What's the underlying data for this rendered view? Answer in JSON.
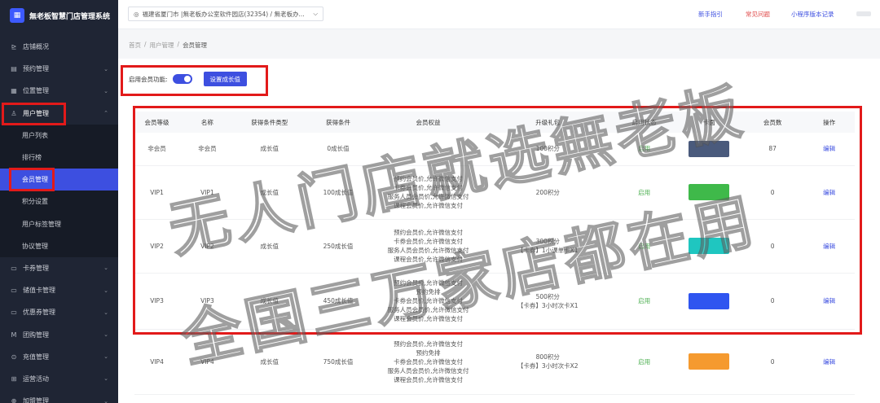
{
  "app": {
    "title": "無老板智慧门店管理系统"
  },
  "sidebar": {
    "items": [
      {
        "icon": "chart-icon",
        "glyph": "⊵",
        "label": "店铺概况",
        "has_chevron": false
      },
      {
        "icon": "calendar-icon",
        "glyph": "▤",
        "label": "预约管理",
        "has_chevron": true
      },
      {
        "icon": "grid-icon",
        "glyph": "▦",
        "label": "位置管理",
        "has_chevron": true
      },
      {
        "icon": "user-icon",
        "glyph": "♙",
        "label": "用户管理",
        "has_chevron": true,
        "open": true
      }
    ],
    "submenu": [
      {
        "label": "用户列表"
      },
      {
        "label": "排行榜"
      },
      {
        "label": "会员管理",
        "active": true
      },
      {
        "label": "积分设置"
      },
      {
        "label": "用户标签管理"
      },
      {
        "label": "协议管理"
      }
    ],
    "items_after": [
      {
        "icon": "card-icon",
        "glyph": "▭",
        "label": "卡券管理"
      },
      {
        "icon": "wallet-icon",
        "glyph": "▭",
        "label": "储值卡管理"
      },
      {
        "icon": "coupon-icon",
        "glyph": "▭",
        "label": "优惠券管理"
      },
      {
        "icon": "group-buy-icon",
        "glyph": "M",
        "label": "团购管理"
      },
      {
        "icon": "recharge-icon",
        "glyph": "⊙",
        "label": "充值管理"
      },
      {
        "icon": "gift-icon",
        "glyph": "⊞",
        "label": "运营活动"
      },
      {
        "icon": "plus-icon",
        "glyph": "⊕",
        "label": "加盟管理"
      }
    ]
  },
  "header": {
    "store": "福建省厦门市 |無老板办公室软件园店(32354) / 無老板办...",
    "links": {
      "guide": "新手指引",
      "faq": "常见问题",
      "changelog": "小程序版本记录"
    }
  },
  "breadcrumb": [
    "首页",
    "用户管理",
    "会员管理"
  ],
  "member_toggle": {
    "label": "启用会员功能:",
    "enabled": true,
    "button": "设置成长值"
  },
  "table": {
    "columns": [
      "会员等级",
      "名称",
      "获得条件类型",
      "获得条件",
      "会员权益",
      "升级礼包",
      "启用状态",
      "卡面",
      "会员数",
      "操作"
    ],
    "rows": [
      {
        "level": "非会员",
        "name": "非会员",
        "cond_type": "成长值",
        "cond": "0成长值",
        "rights": [],
        "gift": [
          "100积分"
        ],
        "status": "启用",
        "card": "#4a5a7c",
        "count": "87",
        "op": "编辑"
      },
      {
        "level": "VIP1",
        "name": "VIP1",
        "cond_type": "成长值",
        "cond": "100成长值",
        "rights": [
          "预约会员价,允许微信支付",
          "卡券会员价,允许微信支付",
          "服务人员会员价,允许微信支付",
          "课程会员价,允许微信支付"
        ],
        "gift": [
          "200积分"
        ],
        "status": "启用",
        "card": "#3fb94a",
        "count": "0",
        "op": "编辑"
      },
      {
        "level": "VIP2",
        "name": "VIP2",
        "cond_type": "成长值",
        "cond": "250成长值",
        "rights": [
          "预约会员价,允许微信支付",
          "卡券会员价,允许微信支付",
          "服务人员会员价,允许微信支付",
          "课程会员价,允许微信支付"
        ],
        "gift": [
          "300积分",
          "【卡券】1小课单卡X1"
        ],
        "status": "启用",
        "card": "#1fc6c0",
        "count": "0",
        "op": "编辑"
      },
      {
        "level": "VIP3",
        "name": "VIP3",
        "cond_type": "成长值",
        "cond": "450成长值",
        "rights": [
          "预约会员价,允许微信支付",
          "预约免排",
          "卡券会员价,允许微信支付",
          "服务人员会员价,允许微信支付",
          "课程会员价,允许微信支付"
        ],
        "gift": [
          "500积分",
          "【卡券】3小时次卡X1"
        ],
        "status": "启用",
        "card": "#2f55f0",
        "count": "0",
        "op": "编辑"
      },
      {
        "level": "VIP4",
        "name": "VIP4",
        "cond_type": "成长值",
        "cond": "750成长值",
        "rights": [
          "预约会员价,允许微信支付",
          "预约免排",
          "卡券会员价,允许微信支付",
          "服务人员会员价,允许微信支付",
          "课程会员价,允许微信支付"
        ],
        "gift": [
          "800积分",
          "【卡券】3小时次卡X2"
        ],
        "status": "启用",
        "card": "#f59a2f",
        "count": "0",
        "op": "编辑"
      }
    ]
  },
  "watermark": {
    "line1": "无人门店就选無老板",
    "line2": "全国三万家店都在用"
  },
  "colors": {
    "sidebar_bg": "#1f2534",
    "accent": "#3d4fe0",
    "highlight": "#e21a1a",
    "enabled_text": "#4caf50"
  }
}
